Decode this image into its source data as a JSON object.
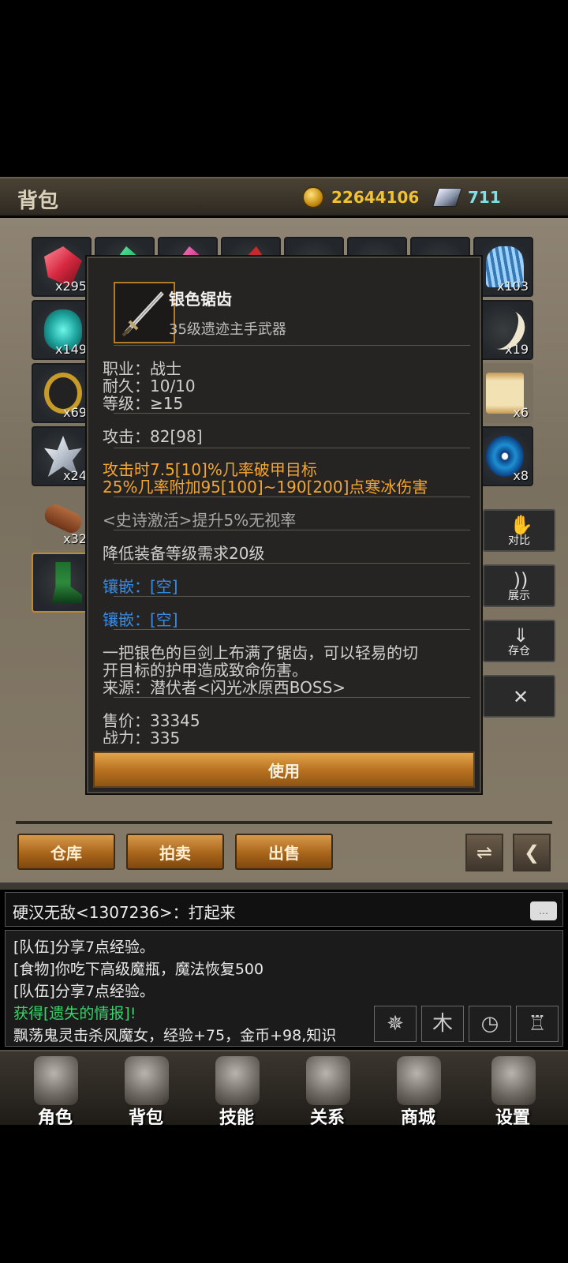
{
  "header": {
    "title": "背包",
    "gold": "22644106",
    "ingot": "711"
  },
  "inventory": {
    "slots": [
      {
        "count": "x295",
        "icon": "red-gem-icon",
        "color": "#d6283f"
      },
      {
        "count": "",
        "icon": "green-gem-icon",
        "color": "#1fbf6d"
      },
      {
        "count": "",
        "icon": "pink-gem-icon",
        "color": "#d33390"
      },
      {
        "count": "",
        "icon": "red-shard-icon",
        "color": "#c62a2a"
      },
      {
        "count": "",
        "icon": "empty-slot-icon",
        "color": "#2a2d30"
      },
      {
        "count": "",
        "icon": "empty-slot-icon",
        "color": "#2a2d30"
      },
      {
        "count": "",
        "icon": "empty-slot-icon",
        "color": "#2a2d30"
      },
      {
        "count": "x103",
        "icon": "blue-wings-icon",
        "color": "#4a90c9"
      },
      {
        "count": "x149",
        "icon": "teal-beetle-icon",
        "color": "#1fa7a0"
      },
      {
        "count": "x19",
        "icon": "tusk-icon",
        "color": "#efe6d0"
      },
      {
        "count": "x69",
        "icon": "gold-ring-icon",
        "color": "#c79b2a"
      },
      {
        "count": "x6",
        "icon": "scroll-icon",
        "color": "#e9d5a2"
      },
      {
        "count": "x24",
        "icon": "silver-crystal-icon",
        "color": "#dfe4ea"
      },
      {
        "count": "x8",
        "icon": "blue-eye-icon",
        "color": "#1d8fd3"
      },
      {
        "count": "x32",
        "icon": "wood-log-icon",
        "color": "#8a4a2a"
      },
      {
        "count": "",
        "icon": "green-boots-icon",
        "color": "#2c8a3c"
      }
    ]
  },
  "popup": {
    "name": "银色锯齿",
    "subtitle": "35级遗迹主手武器",
    "icon": "silver-sword-icon",
    "lines": {
      "class": "职业：战士",
      "durability": "耐久：10/10",
      "level": "等级：≥15",
      "attack": "攻击：82[98]",
      "effect1": "攻击时7.5[10]%几率破甲目标",
      "effect2": "25%几率附加95[100]~190[200]点寒冰伤害",
      "epic": "<史诗激活>提升5%无视率",
      "reduce": "降低装备等级需求20级",
      "socket1": "镶嵌：[空]",
      "socket2": "镶嵌：[空]",
      "desc1": "一把银色的巨剑上布满了锯齿，可以轻易的切",
      "desc2": "开目标的护甲造成致命伤害。",
      "source": "来源：潜伏者<闪光冰原西BOSS>",
      "price": "售价：33345",
      "power": "战力：335"
    },
    "use_label": "使用"
  },
  "side_buttons": {
    "compare": "对比",
    "show": "展示",
    "store": "存仓",
    "close": "✕"
  },
  "bottom_buttons": {
    "warehouse": "仓库",
    "auction": "拍卖",
    "sell": "出售"
  },
  "chat": {
    "current": "硬汉无敌<1307236>：打起来",
    "bubble": "…",
    "log": [
      "[队伍]分享7点经验。",
      "[食物]你吃下高级魔瓶，魔法恢复500",
      "[队伍]分享7点经验。",
      "获得[遗失的情报]!",
      "飘荡鬼灵击杀风魔女，经验+75，金币+98,知识"
    ]
  },
  "nav": [
    {
      "label": "角色",
      "icon": "helmet-icon"
    },
    {
      "label": "背包",
      "icon": "backpack-icon"
    },
    {
      "label": "技能",
      "icon": "skill-book-icon"
    },
    {
      "label": "关系",
      "icon": "handshake-icon"
    },
    {
      "label": "商城",
      "icon": "treasure-chest-icon"
    },
    {
      "label": "设置",
      "icon": "gear-icon"
    }
  ]
}
